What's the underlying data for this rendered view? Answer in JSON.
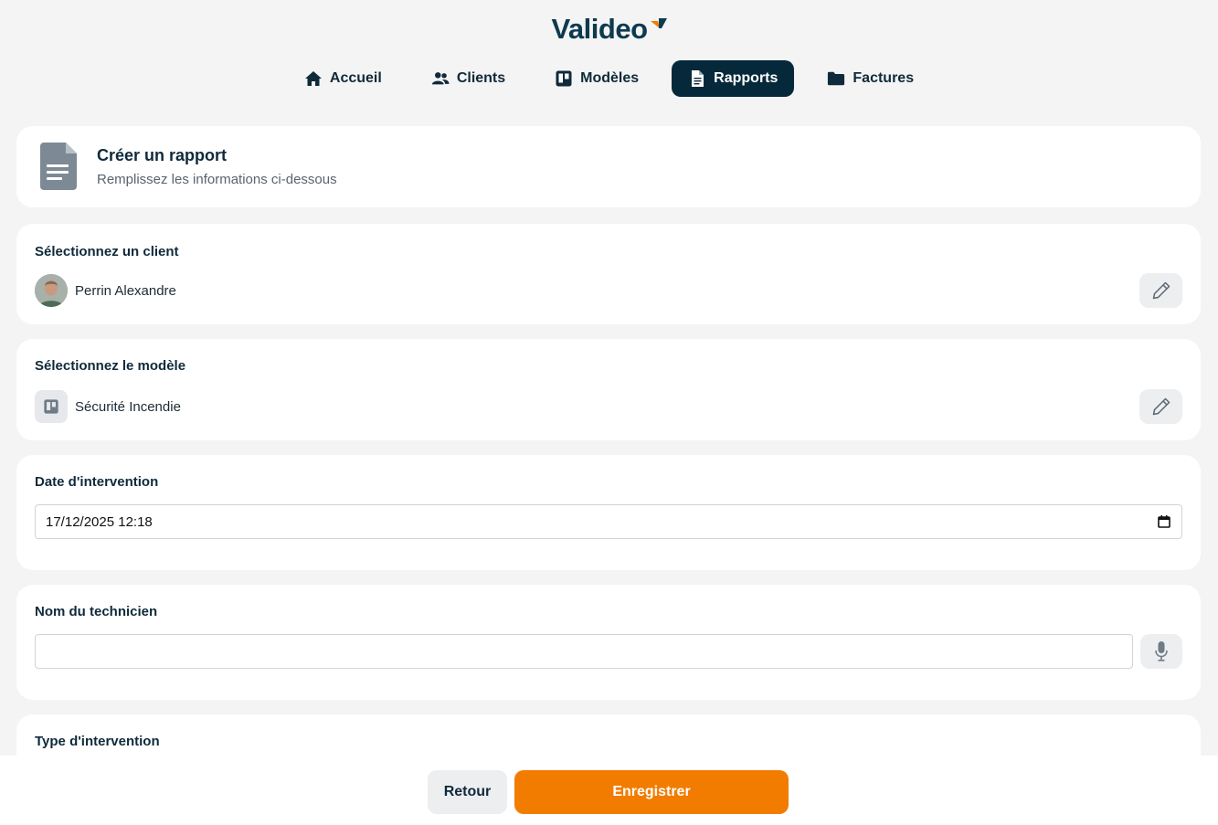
{
  "app": {
    "logo_text": "Valideo"
  },
  "nav": {
    "items": [
      {
        "label": "Accueil",
        "icon": "home-icon"
      },
      {
        "label": "Clients",
        "icon": "users-icon"
      },
      {
        "label": "Modèles",
        "icon": "template-icon"
      },
      {
        "label": "Rapports",
        "icon": "document-icon",
        "active": true
      },
      {
        "label": "Factures",
        "icon": "folder-icon"
      }
    ]
  },
  "header": {
    "title": "Créer un rapport",
    "subtitle": "Remplissez les informations ci-dessous"
  },
  "client_section": {
    "label": "Sélectionnez un client",
    "selected": "Perrin Alexandre"
  },
  "model_section": {
    "label": "Sélectionnez le modèle",
    "selected": "Sécurité Incendie"
  },
  "date_section": {
    "label": "Date d'intervention",
    "value": "17/12/2025 12:18"
  },
  "technician_section": {
    "label": "Nom du technicien",
    "value": ""
  },
  "type_section": {
    "label": "Type d'intervention"
  },
  "footer": {
    "back_label": "Retour",
    "save_label": "Enregistrer"
  },
  "colors": {
    "primary": "#05293a",
    "accent": "#f27c00",
    "background": "#f4f4f4"
  }
}
